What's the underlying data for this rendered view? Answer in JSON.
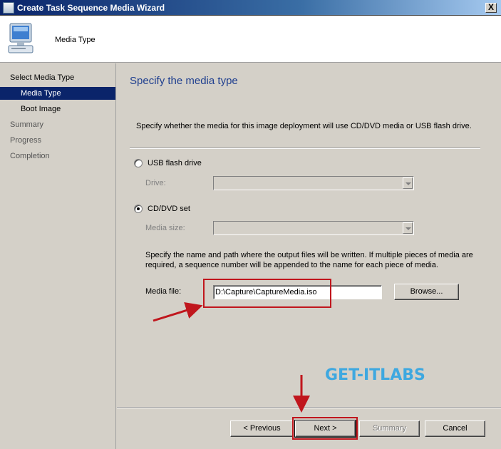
{
  "window": {
    "title": "Create Task Sequence Media Wizard",
    "close_glyph": "X"
  },
  "header": {
    "title": "Media Type",
    "icon": "computer-icon"
  },
  "sidebar": {
    "items": [
      {
        "label": "Select Media Type"
      },
      {
        "label": "Media Type"
      },
      {
        "label": "Boot Image"
      },
      {
        "label": "Summary"
      },
      {
        "label": "Progress"
      },
      {
        "label": "Completion"
      }
    ]
  },
  "main": {
    "page_title": "Specify the media type",
    "description": "Specify whether the media for this image deployment will use CD/DVD media or USB flash drive.",
    "usb": {
      "label": "USB flash drive",
      "checked": false,
      "drive_label": "Drive:",
      "drive_value": ""
    },
    "cddvd": {
      "label": "CD/DVD set",
      "checked": true,
      "size_label": "Media size:",
      "size_value": ""
    },
    "info": "Specify the name and path where the output files will be written.  If multiple pieces of media are required, a sequence number will be appended to the name for each piece of media.",
    "media_file": {
      "label": "Media file:",
      "value": "D:\\Capture\\CaptureMedia.iso"
    },
    "browse_label": "Browse..."
  },
  "watermark": "GET-ITLABS",
  "buttons": {
    "previous": "< Previous",
    "next": "Next >",
    "summary": "Summary",
    "cancel": "Cancel"
  },
  "colors": {
    "highlight": "#c0161d",
    "watermark": "#3ea8e0",
    "active_step": "#0a246a"
  }
}
